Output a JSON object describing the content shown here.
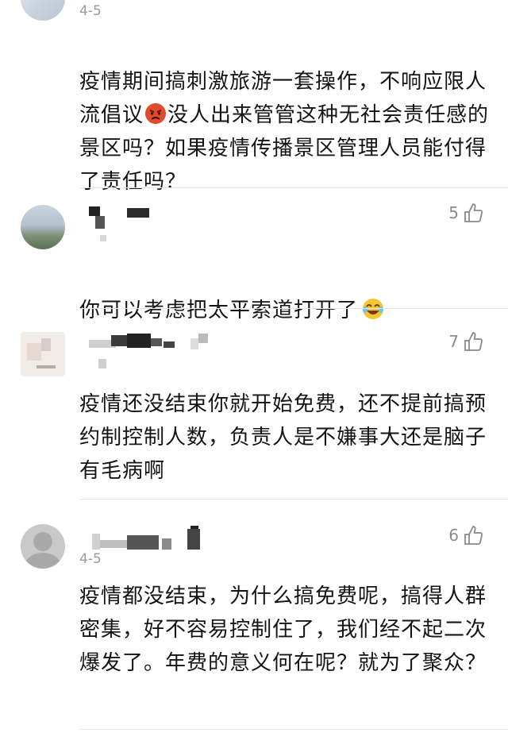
{
  "comments": [
    {
      "date": "4-5",
      "text_before_emoji": "疫情期间搞刺激旅游一套操作，不响应限人流倡议",
      "text_after_emoji": "没人出来管管这种无社会责任感的景区吗？如果疫情传播景区管理人员能付得了责任吗？",
      "emoji": "angry-face-emoji"
    },
    {
      "likes": "5",
      "text_before_emoji": "你可以考虑把太平索道打开了",
      "emoji": "laughing-tears-emoji"
    },
    {
      "likes": "7",
      "text": "疫情还没结束你就开始免费，还不提前搞预约制控制人数，负责人是不嫌事大还是脑子有毛病啊"
    },
    {
      "date": "4-5",
      "likes": "6",
      "text": "疫情都没结束，为什么搞免费呢，搞得人群密集，好不容易控制住了，我们经不起二次爆发了。年费的意义何在呢？就为了聚众？"
    }
  ],
  "icons": {
    "like": "thumbs-up-icon"
  }
}
